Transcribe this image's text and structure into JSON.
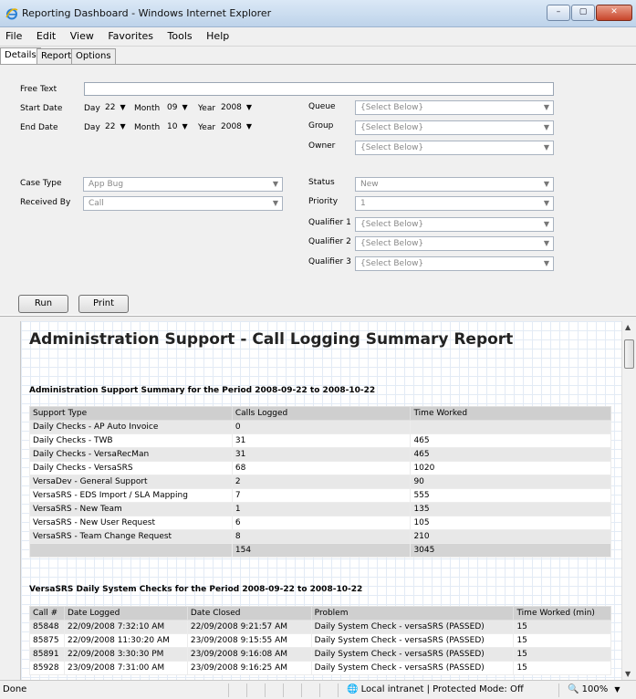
{
  "window": {
    "title": "Reporting Dashboard - Windows Internet Explorer",
    "minimize": "–",
    "maximize": "▢",
    "close": "✕"
  },
  "menu": [
    "File",
    "Edit",
    "View",
    "Favorites",
    "Tools",
    "Help"
  ],
  "tabs": [
    "Details",
    "Report",
    "Options"
  ],
  "form": {
    "free_text_label": "Free Text",
    "free_text_value": "",
    "start_date_label": "Start Date",
    "end_date_label": "End Date",
    "day_label": "Day",
    "month_label": "Month",
    "year_label": "Year",
    "start_day": "22",
    "start_month": "09",
    "start_year": "2008",
    "end_day": "22",
    "end_month": "10",
    "end_year": "2008",
    "queue_label": "Queue",
    "queue_value": "{Select Below}",
    "group_label": "Group",
    "group_value": "{Select Below}",
    "owner_label": "Owner",
    "owner_value": "{Select Below}",
    "case_type_label": "Case Type",
    "case_type_value": "App Bug",
    "received_by_label": "Received By",
    "received_by_value": "Call",
    "status_label": "Status",
    "status_value": "New",
    "priority_label": "Priority",
    "priority_value": "1",
    "qualifier1_label": "Qualifier 1",
    "qualifier1_value": "{Select Below}",
    "qualifier2_label": "Qualifier 2",
    "qualifier2_value": "{Select Below}",
    "qualifier3_label": "Qualifier 3",
    "qualifier3_value": "{Select Below}",
    "run_label": "Run",
    "print_label": "Print"
  },
  "report": {
    "title": "Administration Support - Call Logging Summary Report",
    "summary_heading": "Administration Support Summary for the Period 2008-09-22 to 2008-10-22",
    "summary_columns": [
      "Support Type",
      "Calls Logged",
      "Time Worked"
    ],
    "summary_rows": [
      [
        "Daily Checks - AP Auto Invoice",
        "0",
        ""
      ],
      [
        "Daily Checks - TWB",
        "31",
        "465"
      ],
      [
        "Daily Checks - VersaRecMan",
        "31",
        "465"
      ],
      [
        "Daily Checks - VersaSRS",
        "68",
        "1020"
      ],
      [
        "VersaDev - General Support",
        "2",
        "90"
      ],
      [
        "VersaSRS - EDS Import / SLA Mapping",
        "7",
        "555"
      ],
      [
        "VersaSRS - New Team",
        "1",
        "135"
      ],
      [
        "VersaSRS - New User Request",
        "6",
        "105"
      ],
      [
        "VersaSRS - Team Change Request",
        "8",
        "210"
      ]
    ],
    "summary_total": [
      "",
      "154",
      "3045"
    ],
    "daily_heading": "VersaSRS Daily System Checks for the Period 2008-09-22 to 2008-10-22",
    "daily_columns": [
      "Call #",
      "Date Logged",
      "Date Closed",
      "Problem",
      "Time Worked (min)"
    ],
    "daily_rows": [
      [
        "85848",
        "22/09/2008 7:32:10 AM",
        "22/09/2008 9:21:57 AM",
        "Daily System Check - versaSRS (PASSED)",
        "15"
      ],
      [
        "85875",
        "22/09/2008 11:30:20 AM",
        "23/09/2008 9:15:55 AM",
        "Daily System Check - versaSRS (PASSED)",
        "15"
      ],
      [
        "85891",
        "22/09/2008 3:30:30 PM",
        "23/09/2008 9:16:08 AM",
        "Daily System Check - versaSRS (PASSED)",
        "15"
      ],
      [
        "85928",
        "23/09/2008 7:31:00 AM",
        "23/09/2008 9:16:25 AM",
        "Daily System Check - versaSRS (PASSED)",
        "15"
      ]
    ]
  },
  "status": {
    "done": "Done",
    "zone": "Local intranet | Protected Mode: Off",
    "zoom": "100%"
  }
}
